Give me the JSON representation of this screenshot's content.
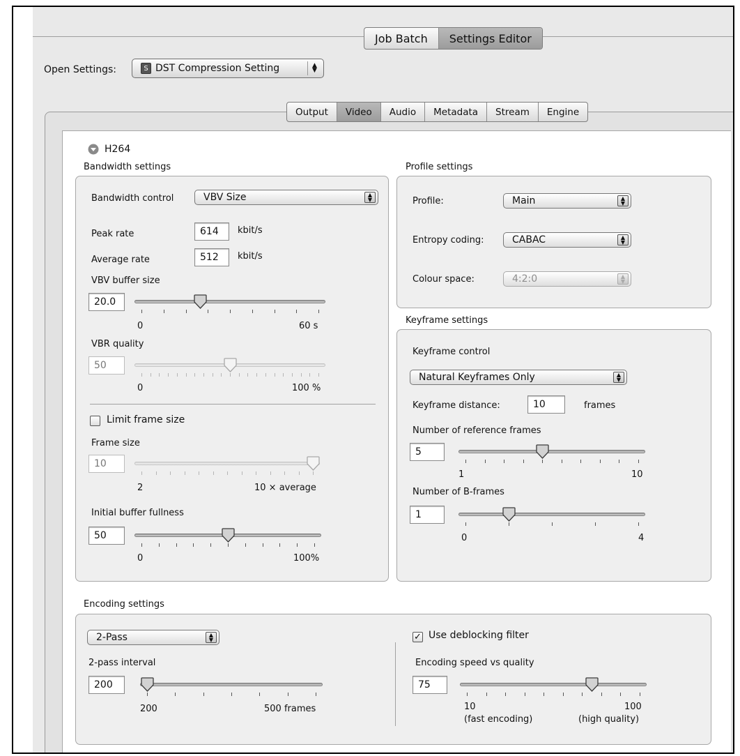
{
  "window_tabs": [
    "Job Batch",
    "Settings Editor"
  ],
  "window_tabs_selected": "Settings Editor",
  "open_settings": {
    "label": "Open Settings:",
    "value": "DST Compression Setting",
    "icon_letter": "S",
    "icon": "settings-file-icon"
  },
  "settings_tabs": [
    "Output",
    "Video",
    "Audio",
    "Metadata",
    "Stream",
    "Engine"
  ],
  "settings_tabs_selected": "Video",
  "codec": {
    "label": "H264",
    "icon": "disclosure-triangle-down-icon"
  },
  "bandwidth": {
    "heading": "Bandwidth settings",
    "control_label": "Bandwidth control",
    "control_value": "VBV Size",
    "peak_rate_label": "Peak rate",
    "peak_rate_value": "614",
    "peak_rate_unit": "kbit/s",
    "average_rate_label": "Average rate",
    "average_rate_value": "512",
    "average_rate_unit": "kbit/s",
    "vbv_buffer": {
      "label": "VBV buffer size",
      "value": "20.0",
      "min_label": "0",
      "max_label": "60 s",
      "min": 0,
      "max": 60,
      "position": 20.0
    },
    "vbr_quality": {
      "label": "VBR quality",
      "value": "50",
      "min_label": "0",
      "max_label": "100 %",
      "min": 0,
      "max": 100,
      "position": 50,
      "disabled": true
    },
    "limit_frame_size": {
      "label": "Limit frame size",
      "checked": false
    },
    "frame_size": {
      "label": "Frame size",
      "value": "10",
      "min_label": "2",
      "max_label": "10 × average",
      "min": 2,
      "max": 10,
      "position": 10,
      "disabled": true
    },
    "initial_buffer": {
      "label": "Initial buffer fullness",
      "value": "50",
      "min_label": "0",
      "max_label": "100%",
      "min": 0,
      "max": 100,
      "position": 50
    }
  },
  "profile": {
    "heading": "Profile settings",
    "profile_label": "Profile:",
    "profile_value": "Main",
    "entropy_label": "Entropy coding:",
    "entropy_value": "CABAC",
    "colour_label": "Colour space:",
    "colour_value": "4:2:0"
  },
  "keyframe": {
    "heading": "Keyframe settings",
    "control_label": "Keyframe control",
    "control_value": "Natural Keyframes Only",
    "distance_label": "Keyframe distance:",
    "distance_value": "10",
    "distance_unit": "frames",
    "ref_frames": {
      "label": "Number of reference frames",
      "value": "5",
      "min_label": "1",
      "max_label": "10",
      "min": 1,
      "max": 10,
      "position": 5
    },
    "b_frames": {
      "label": "Number of B-frames",
      "value": "1",
      "min_label": "0",
      "max_label": "4",
      "min": 0,
      "max": 4,
      "position": 1
    }
  },
  "encoding": {
    "heading": "Encoding settings",
    "mode_value": "2-Pass",
    "interval": {
      "label": "2-pass interval",
      "value": "200",
      "min_label": "200",
      "max_label": "500 frames",
      "min": 200,
      "max": 500,
      "position": 200
    },
    "deblocking": {
      "label": "Use deblocking filter",
      "checked": true
    },
    "speed_quality": {
      "label": "Encoding speed vs quality",
      "value": "75",
      "min_label": "10",
      "max_label": "100",
      "min_sub": "(fast encoding)",
      "max_sub": "(high quality)",
      "min": 10,
      "max": 100,
      "position": 75
    }
  }
}
